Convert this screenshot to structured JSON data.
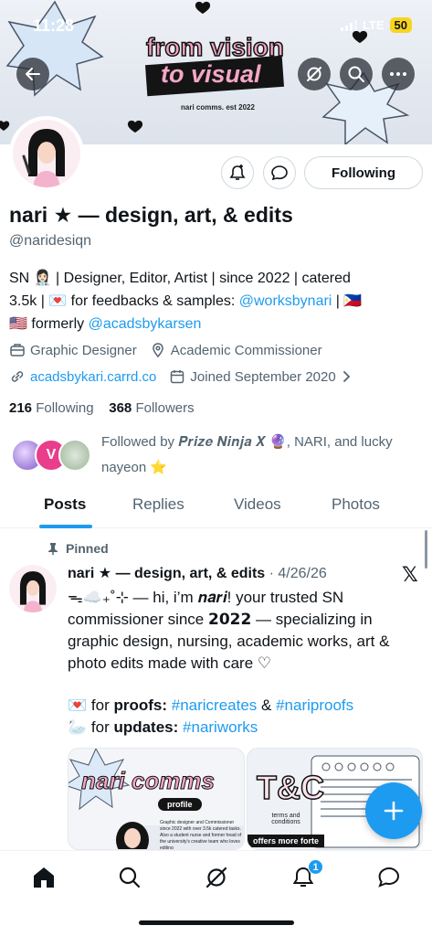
{
  "status_bar": {
    "time": "11:28",
    "network": "LTE",
    "battery": "50"
  },
  "banner": {
    "line1": "from vision",
    "line2": "to visual",
    "subtitle": "nari comms. est 2022"
  },
  "profile": {
    "name": "nari ★ — design, art, & edits",
    "handle": "@naridesiqn",
    "bio_line1": "SN 👩🏻‍⚕️ | Designer, Editor, Artist | since 2022 | catered",
    "bio_line2_a": "3.5k | 💌 for feedbacks & samples: ",
    "bio_link1": "@worksbynari",
    "bio_line2_b": " | 🇵🇭",
    "bio_line3_a": "🇺🇸 formerly ",
    "bio_link2": "@acadsbykarsen",
    "category": "Graphic Designer",
    "location": "Academic Commissioner",
    "website": "acadsbykari.carrd.co",
    "joined": "Joined September 2020",
    "following_count": "216",
    "following_label": "Following",
    "followers_count": "368",
    "followers_label": "Followers",
    "followed_by": "Followed by 𝑷𝒓𝒊𝒛𝒆 𝑵𝒊𝒏𝒋𝒂 𝑿 🔮, NARI, and lucky nayeon ⭐"
  },
  "actions": {
    "following_button": "Following"
  },
  "tabs": [
    {
      "label": "Posts",
      "active": true
    },
    {
      "label": "Replies",
      "active": false
    },
    {
      "label": "Videos",
      "active": false
    },
    {
      "label": "Photos",
      "active": false
    }
  ],
  "tweet": {
    "pinned_label": "Pinned",
    "author": "nari ★ — design, art, & edits",
    "date": "4/26/26",
    "body": "ᯓ☁️₊˚⊹ — hi, i’m 𝒏𝒂𝒓𝒊! your trusted SN commissioner since 𝟮𝟬𝟮𝟮 — specializing in graphic design, nursing, academic works, art & photo edits made with care ♡",
    "line_proofs_prefix": "💌 for ",
    "line_proofs_bold": "proofs:",
    "hashtag1": "#naricreates",
    "amp": " & ",
    "hashtag2": "#nariproofs",
    "line_updates_prefix": "🦢 for ",
    "line_updates_bold": "updates:",
    "hashtag3": "#nariworks",
    "media1_title": "nari comms",
    "media1_tag": "profile",
    "media1_caption": "Graphic designer and Commissioner since 2022 with over 3.5k catered tasks. Also a student nurse and former head of the university's creative team who loves editing",
    "media2_title": "T&C",
    "media2_tag": "terms and conditions",
    "media2_footer": "offers more forte"
  },
  "bottom_nav": {
    "notification_count": "1"
  },
  "colors": {
    "accent": "#1d9bf0",
    "text": "#0f1419",
    "muted": "#536471",
    "border": "#cfd9de"
  }
}
